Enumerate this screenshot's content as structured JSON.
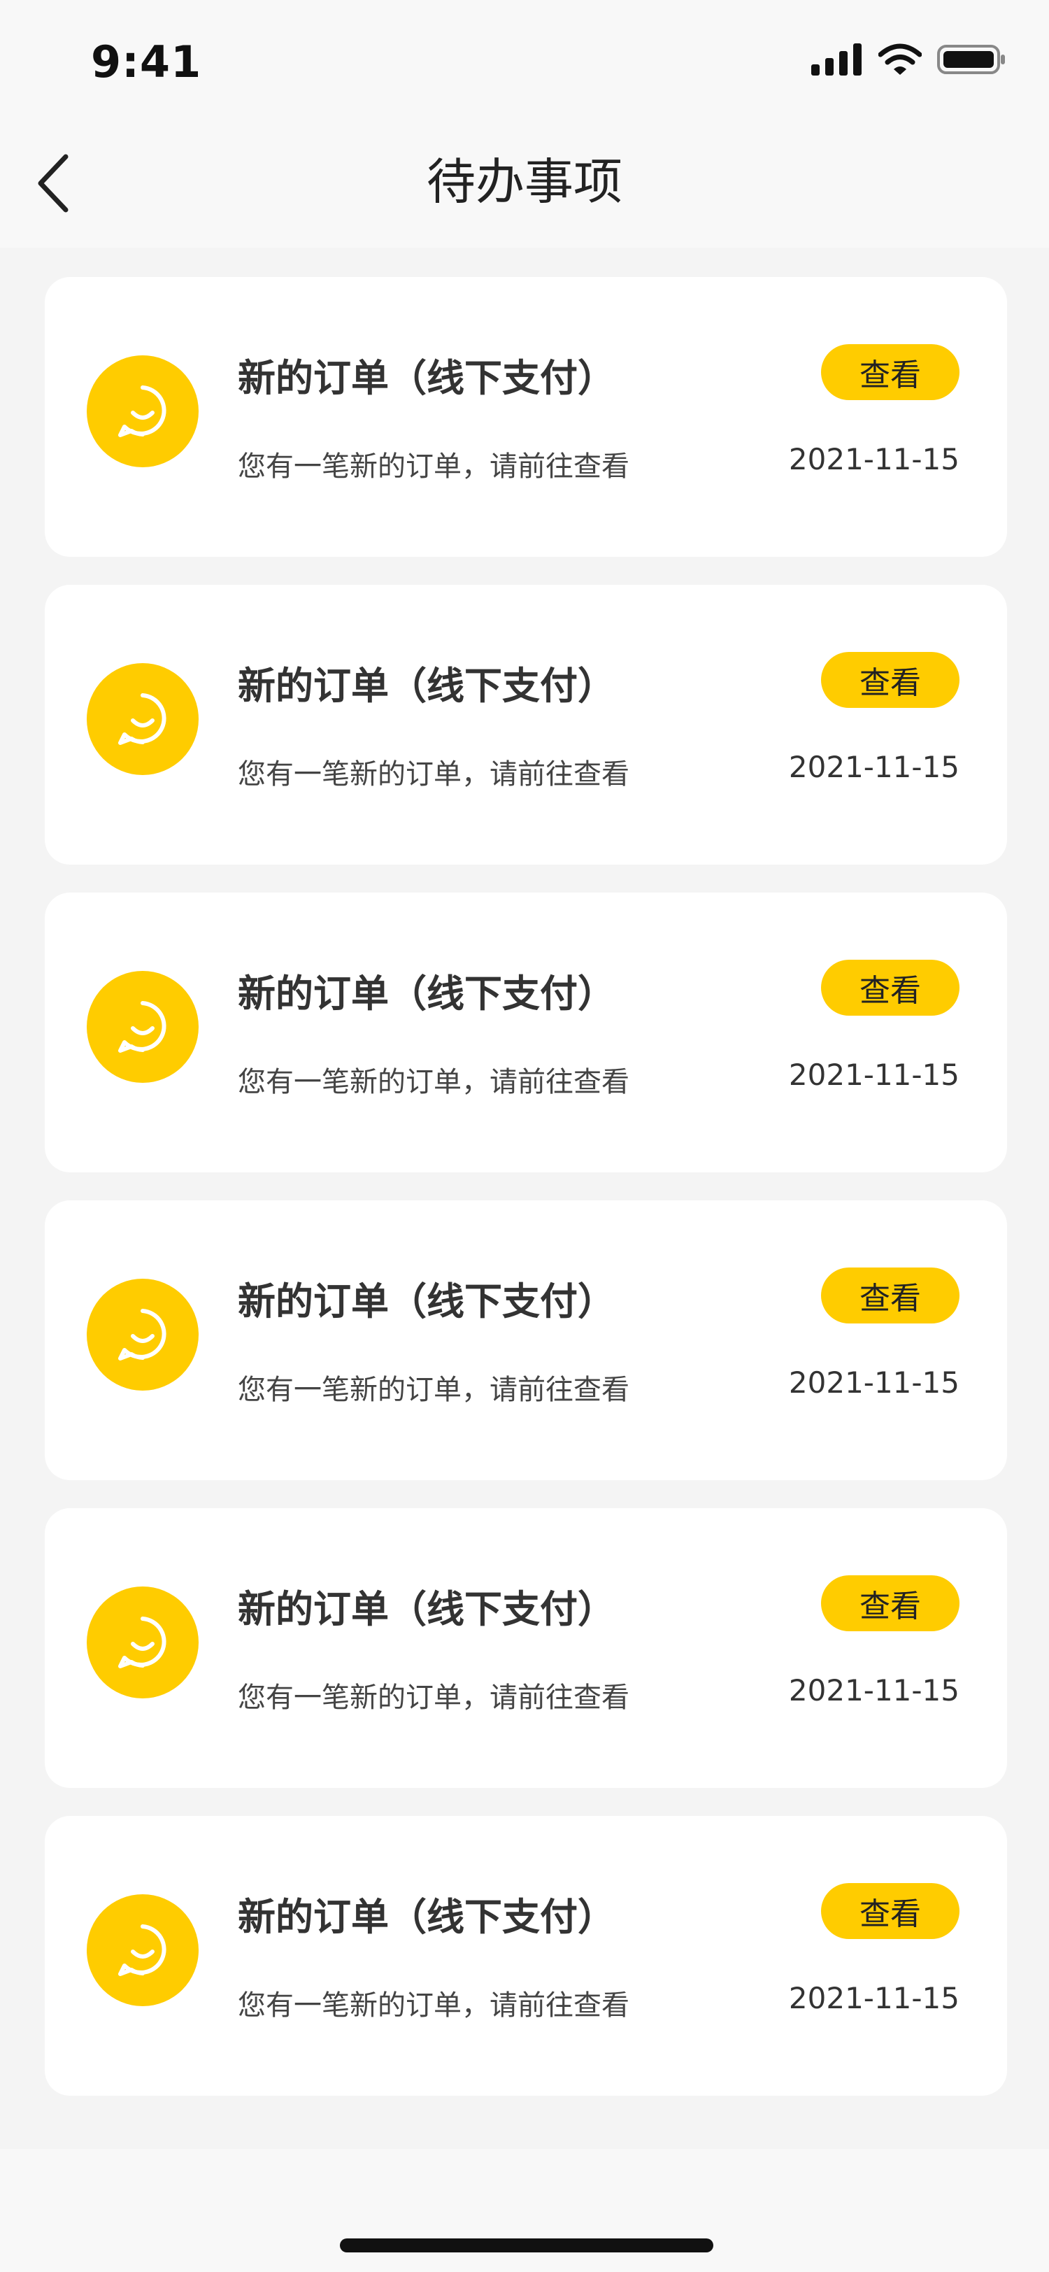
{
  "status_bar": {
    "time": "9:41"
  },
  "nav": {
    "title": "待办事项",
    "back_icon": "chevron-left-icon"
  },
  "colors": {
    "accent": "#ffcc00",
    "card_background": "#ffffff",
    "page_background": "#f4f4f4"
  },
  "items": [
    {
      "title": "新的订单（线下支付）",
      "description": "您有一笔新的订单，请前往查看",
      "button": "查看",
      "date": "2021-11-15",
      "icon": "chat-smile-icon"
    },
    {
      "title": "新的订单（线下支付）",
      "description": "您有一笔新的订单，请前往查看",
      "button": "查看",
      "date": "2021-11-15",
      "icon": "chat-smile-icon"
    },
    {
      "title": "新的订单（线下支付）",
      "description": "您有一笔新的订单，请前往查看",
      "button": "查看",
      "date": "2021-11-15",
      "icon": "chat-smile-icon"
    },
    {
      "title": "新的订单（线下支付）",
      "description": "您有一笔新的订单，请前往查看",
      "button": "查看",
      "date": "2021-11-15",
      "icon": "chat-smile-icon"
    },
    {
      "title": "新的订单（线下支付）",
      "description": "您有一笔新的订单，请前往查看",
      "button": "查看",
      "date": "2021-11-15",
      "icon": "chat-smile-icon"
    },
    {
      "title": "新的订单（线下支付）",
      "description": "您有一笔新的订单，请前往查看",
      "button": "查看",
      "date": "2021-11-15",
      "icon": "chat-smile-icon"
    }
  ]
}
